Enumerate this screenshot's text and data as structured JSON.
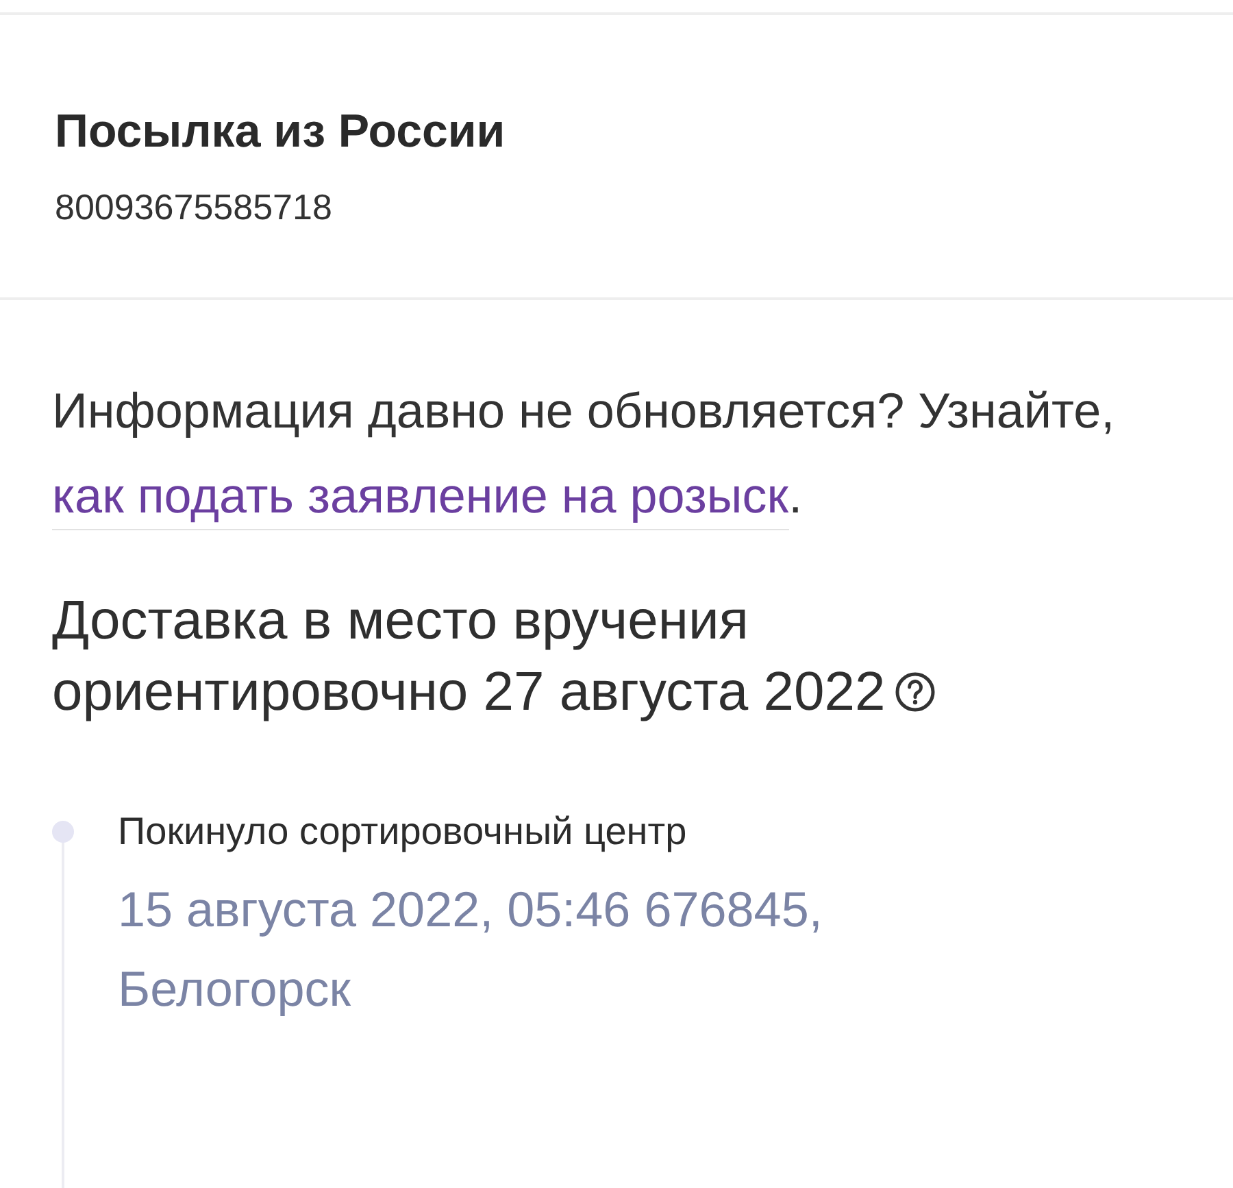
{
  "header": {
    "title": "Посылка из России",
    "tracking_number": "80093675585718"
  },
  "notice": {
    "text": "Информация давно не обновляется? Узнайте, ",
    "link": "как подать заявление на розыск",
    "end": "."
  },
  "delivery": {
    "text": "Доставка в место вручения ориентировочно 27 августа 2022"
  },
  "events": [
    {
      "title": "Покинуло сортировочный центр",
      "details": "15 августа 2022, 05:46 676845, Белогорск"
    }
  ]
}
